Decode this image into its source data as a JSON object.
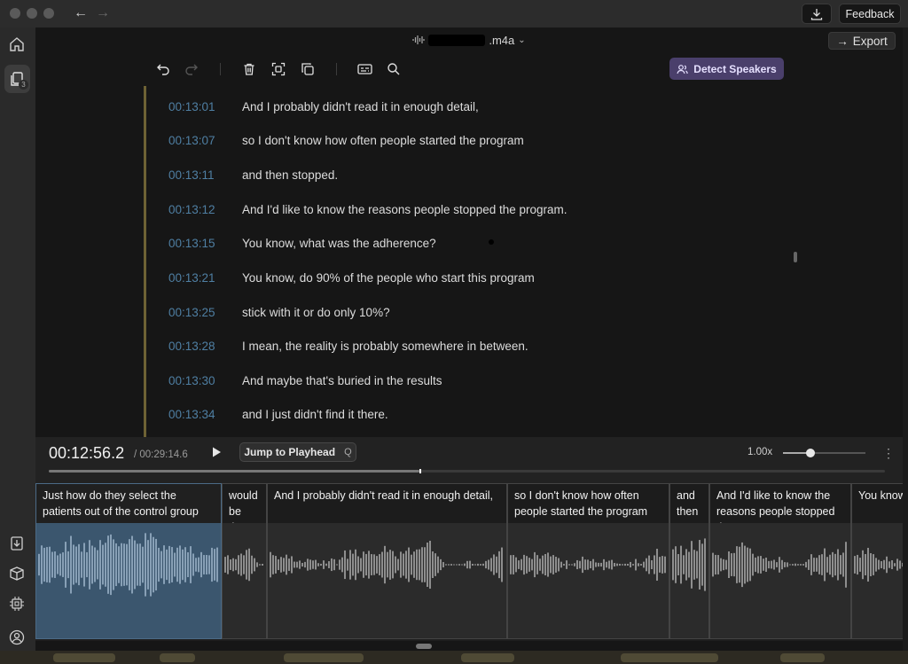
{
  "titlebar": {
    "download_icon": "download-icon",
    "feedback_label": "Feedback"
  },
  "sidebar": {
    "icons": [
      "home-icon",
      "files-icon",
      "import-icon",
      "package-icon",
      "chip-icon",
      "account-icon"
    ],
    "files_badge": "3"
  },
  "file": {
    "name_suffix": ".m4a",
    "export_label": "Export"
  },
  "toolbar": {
    "detect_speakers_label": "Detect Speakers"
  },
  "transcript": [
    {
      "time": "00:13:01",
      "text": "And I probably didn't read it in enough detail,"
    },
    {
      "time": "00:13:07",
      "text": "so I don't know how often people started the program"
    },
    {
      "time": "00:13:11",
      "text": "and then stopped."
    },
    {
      "time": "00:13:12",
      "text": "And I'd like to know the reasons people stopped the program."
    },
    {
      "time": "00:13:15",
      "text": "You know, what was the adherence?"
    },
    {
      "time": "00:13:21",
      "text": "You know, do 90% of the people who start this program"
    },
    {
      "time": "00:13:25",
      "text": "stick with it or do only 10%?"
    },
    {
      "time": "00:13:28",
      "text": "I mean, the reality is probably somewhere in between."
    },
    {
      "time": "00:13:30",
      "text": "And maybe that's buried in the results"
    },
    {
      "time": "00:13:34",
      "text": "and I just didn't find it there."
    }
  ],
  "player": {
    "current_time": "00:12:56.2",
    "total_time": "/ 00:29:14.6",
    "jump_label": "Jump to Playhead",
    "jump_key": "Q",
    "speed": "1.00x",
    "speed_fraction": 0.33,
    "progress_fraction": 0.443
  },
  "timeline": [
    {
      "text": "Just how do they select the patients out of the control group",
      "active": true
    },
    {
      "text": "would be the...",
      "active": false
    },
    {
      "text": "And I probably didn't read it in enough detail,",
      "active": false
    },
    {
      "text": "so I don't know how often people started the program",
      "active": false
    },
    {
      "text": "and then stopped.",
      "active": false
    },
    {
      "text": "And I'd like to know the reasons people stopped the program.",
      "active": false
    },
    {
      "text": "You know",
      "active": false
    }
  ]
}
